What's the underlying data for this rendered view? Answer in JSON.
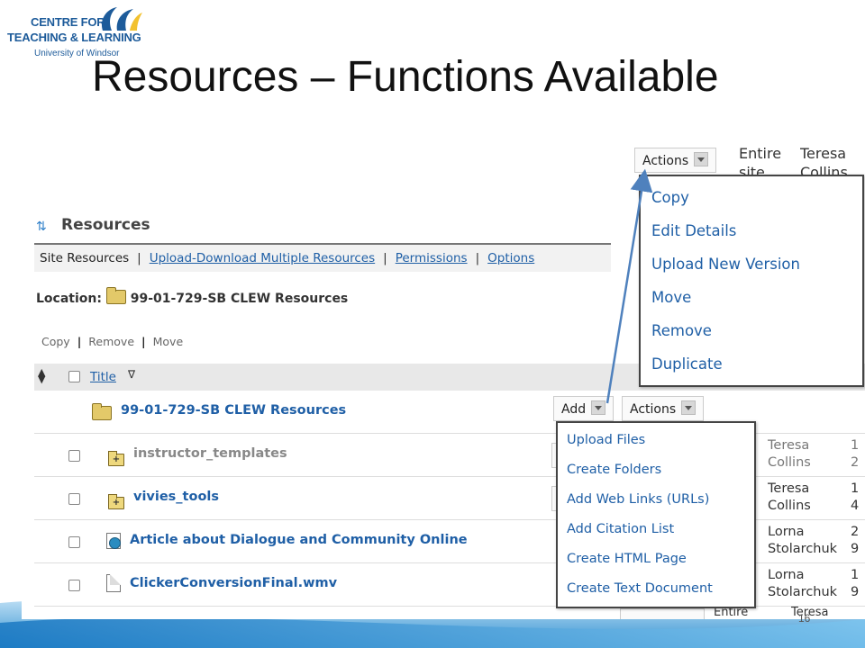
{
  "slide": {
    "title": "Resources – Functions Available",
    "page_number": "16",
    "logo": {
      "line1": "CENTRE FOR",
      "line2": "TEACHING & LEARNING",
      "line3": "University of Windsor"
    }
  },
  "resources": {
    "heading": "Resources",
    "toolbar": {
      "site_resources": "Site Resources",
      "upload_download": "Upload-Download Multiple Resources",
      "permissions": "Permissions",
      "options": "Options"
    },
    "location_label": "Location:",
    "location_value": "99-01-729-SB CLEW Resources",
    "commands": {
      "copy": "Copy",
      "remove": "Remove",
      "move": "Move"
    },
    "column_title": "Title",
    "root_folder": {
      "name": "99-01-729-SB CLEW Resources",
      "add_label": "Add",
      "actions_label": "Actions"
    },
    "rows": [
      {
        "name": "instructor_templates",
        "creator": [
          "Teresa",
          "Collins"
        ],
        "mod": [
          "1",
          "2"
        ]
      },
      {
        "name": "vivies_tools",
        "creator": [
          "Teresa",
          "Collins"
        ],
        "mod": [
          "1",
          "4"
        ]
      },
      {
        "name": "Article about Dialogue and Community Online",
        "creator": [
          "Lorna",
          "Stolarchuk"
        ],
        "mod": [
          "2",
          "9"
        ]
      },
      {
        "name": "ClickerConversionFinal.wmv",
        "creator": [
          "Lorna",
          "Stolarchuk"
        ],
        "mod": [
          "1",
          "9"
        ]
      }
    ],
    "partial_bottom": {
      "access": "Entire",
      "creator": "Teresa"
    }
  },
  "actions_menu": {
    "button_label": "Actions",
    "access_header": [
      "Entire",
      "site"
    ],
    "creator_header": [
      "Teresa",
      "Collins"
    ],
    "items": [
      "Copy",
      "Edit Details",
      "Upload New Version",
      "Move",
      "Remove",
      "Duplicate"
    ]
  },
  "add_menu": {
    "items": [
      "Upload Files",
      "Create Folders",
      "Add Web Links (URLs)",
      "Add Citation List",
      "Create HTML Page",
      "Create Text Document"
    ]
  },
  "colors": {
    "link": "#1f5fa6",
    "logo_blue": "#1d5b9a",
    "logo_yellow": "#f2c12e",
    "arrow": "#4f81bd"
  }
}
